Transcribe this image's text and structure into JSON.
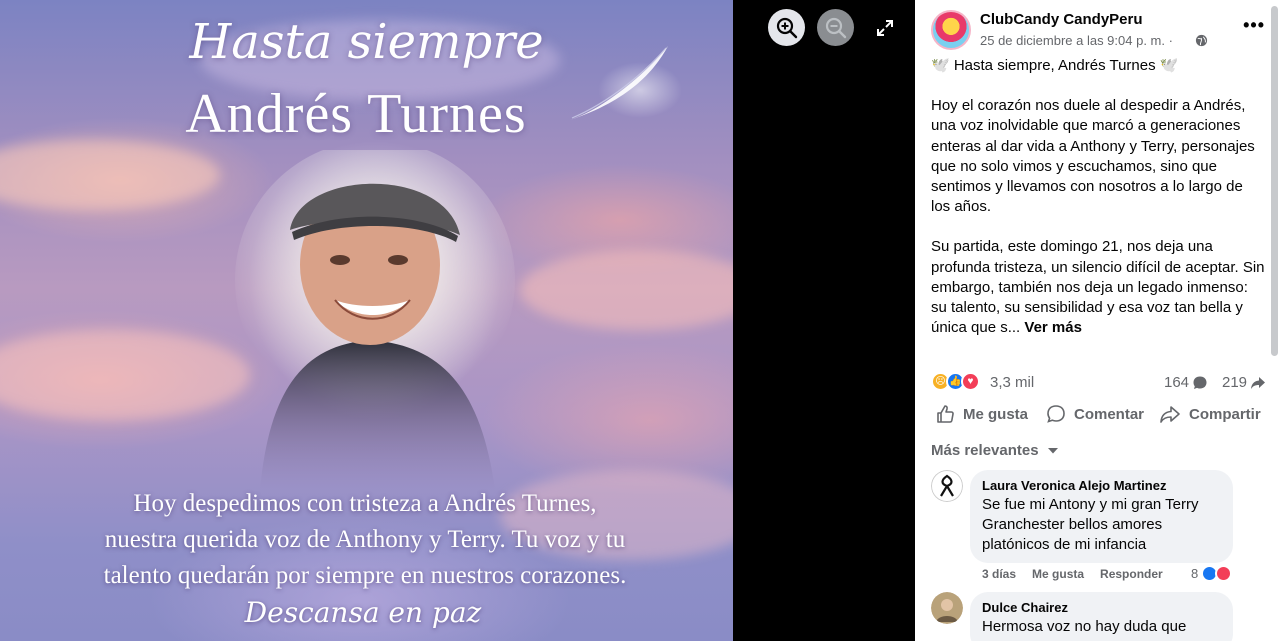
{
  "photo": {
    "title_line1": "Hasta siempre",
    "title_line2": "Andrés Turnes",
    "caption_lines": [
      "Hoy despedimos con tristeza a Andrés Turnes,",
      "nuestra querida voz de Anthony y Terry. Tu voz y tu",
      "talento quedarán por siempre en nuestros corazones."
    ],
    "closing": "Descansa en paz"
  },
  "viewer_controls": {
    "zoom_in_icon": "zoom-in-icon",
    "zoom_out_icon": "zoom-out-icon",
    "expand_icon": "expand-icon"
  },
  "post": {
    "page_name": "ClubCandy CandyPeru",
    "date": "25 de diciembre a las 9:04 p. m. ·",
    "more_label": "•••",
    "text_heading": "🕊️ Hasta siempre, Andrés Turnes 🕊️",
    "paragraph_1": "Hoy el corazón nos duele al despedir a Andrés, una voz inolvidable que marcó a generaciones enteras al dar vida a Anthony y Terry, personajes que no solo vimos y escuchamos, sino que sentimos y llevamos con nosotros a lo largo de los años.",
    "paragraph_2": "Su partida, este domingo 21, nos deja una profunda tristeza, un silencio difícil de aceptar. Sin embargo, también nos deja un legado inmenso: su talento, su sensibilidad y esa voz tan bella y única que s...",
    "see_more": "Ver más"
  },
  "stats": {
    "reactions": "3,3 mil",
    "comments": "164",
    "shares": "219"
  },
  "actions": {
    "like": "Me gusta",
    "comment": "Comentar",
    "share": "Compartir"
  },
  "filter": {
    "label": "Más relevantes"
  },
  "comments": [
    {
      "name": "Laura Veronica Alejo Martinez",
      "text": "Se fue mi Antony y mi gran Terry Granchester bellos amores platónicos de mi infancia",
      "time": "3 días",
      "like": "Me gusta",
      "reply": "Responder",
      "reactions": "8"
    },
    {
      "name": "Dulce Chairez",
      "text": "Hermosa voz no hay duda que"
    }
  ],
  "colors": {
    "accent_blue": "#1877f2",
    "love_red": "#f33e58",
    "sad_yellow": "#f7b125",
    "muted_text": "#65676b",
    "bubble_bg": "#f0f2f5"
  }
}
